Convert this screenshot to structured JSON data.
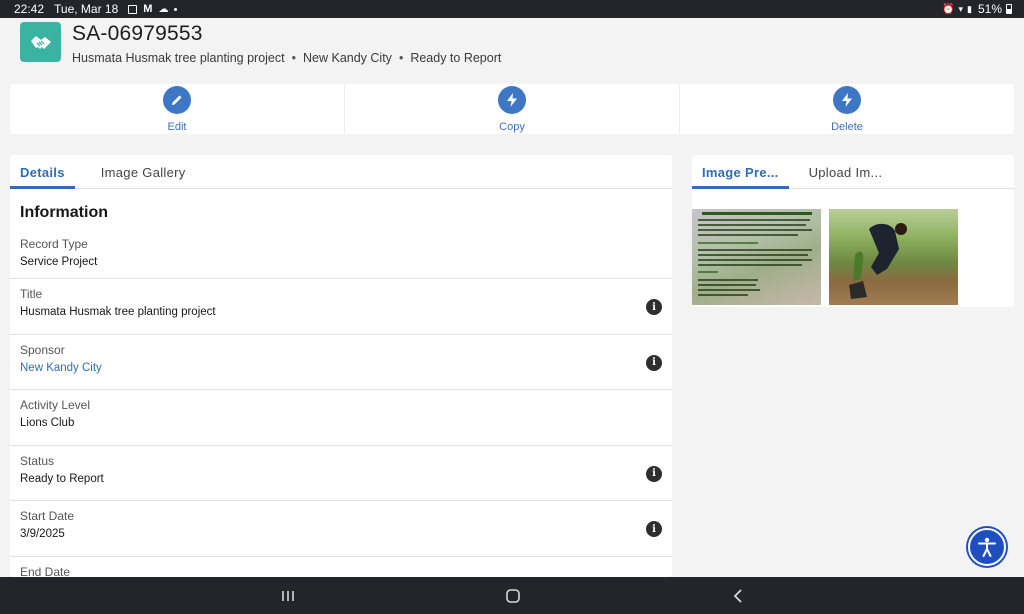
{
  "status_bar": {
    "time": "22:42",
    "date": "Tue, Mar 18",
    "battery": "51%"
  },
  "record": {
    "id": "SA-06979553",
    "subtitle": [
      "Husmata Husmak tree planting project",
      "New Kandy City",
      "Ready to Report"
    ],
    "separator": "•"
  },
  "actions": [
    {
      "label": "Edit",
      "icon": "pencil-icon"
    },
    {
      "label": "Copy",
      "icon": "lightning-icon"
    },
    {
      "label": "Delete",
      "icon": "lightning-icon"
    }
  ],
  "left_tabs": [
    "Details",
    "Image Gallery"
  ],
  "section_title": "Information",
  "fields": [
    {
      "label": "Record Type",
      "value": "Service Project",
      "info": false,
      "link": false
    },
    {
      "label": "Title",
      "value": "Husmata Husmak tree planting project",
      "info": true,
      "link": false
    },
    {
      "label": "Sponsor",
      "value": "New Kandy City",
      "info": true,
      "link": true
    },
    {
      "label": "Activity Level",
      "value": "Lions Club",
      "info": false,
      "link": false
    },
    {
      "label": "Status",
      "value": "Ready to Report",
      "info": true,
      "link": false
    },
    {
      "label": "Start Date",
      "value": "3/9/2025",
      "info": true,
      "link": false
    },
    {
      "label": "End Date",
      "value": "",
      "info": true,
      "link": false
    }
  ],
  "right_tabs": [
    "Image Pre...",
    "Upload Im..."
  ],
  "info_glyph": "i",
  "colors": {
    "brand_blue": "#3e78c5",
    "record_icon": "#3bb3a3",
    "a11y_button": "#1f4fbf"
  }
}
